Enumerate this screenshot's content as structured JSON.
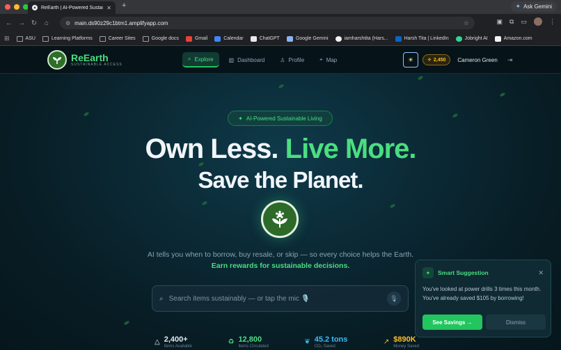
{
  "browser": {
    "tab_title": "ReEarth | AI-Powered Sustai",
    "tab_close": "✕",
    "new_tab": "+",
    "ask_gemini": "Ask Gemini",
    "url": "main.ds90z29c1btm1.amplifyapp.com",
    "bookmarks": [
      {
        "label": "ASU",
        "icon": "folder-icon"
      },
      {
        "label": "Learning Platforms",
        "icon": "folder-icon"
      },
      {
        "label": "Career Sites",
        "icon": "folder-icon"
      },
      {
        "label": "Google docs",
        "icon": "folder-icon"
      },
      {
        "label": "Gmail",
        "icon": "gmail-icon"
      },
      {
        "label": "Calendar",
        "icon": "calendar-icon"
      },
      {
        "label": "ChatGPT",
        "icon": "chatgpt-icon"
      },
      {
        "label": "Google Gemini",
        "icon": "gemini-icon"
      },
      {
        "label": "iamharshtita (Hars...",
        "icon": "github-icon"
      },
      {
        "label": "Harsh Tita | LinkedIn",
        "icon": "linkedin-icon"
      },
      {
        "label": "Jobright AI",
        "icon": "jobright-icon"
      },
      {
        "label": "Amazon.com",
        "icon": "amazon-icon"
      }
    ]
  },
  "app": {
    "brand": "ReEarth",
    "brand_sub": "SUSTAINABLE ACCESS",
    "nav": {
      "explore": "Explore",
      "dashboard": "Dashboard",
      "profile": "Profile",
      "map": "Map"
    },
    "points": "2,450",
    "user_name": "Cameron Green"
  },
  "hero": {
    "badge": "AI-Powered Sustainable Living",
    "line1_a": "Own Less.",
    "line1_b": "Live More.",
    "line2": "Save the Planet.",
    "description": "AI tells you when to borrow, buy resale, or skip — so every choice helps the Earth.",
    "description_highlight": "Earn rewards for sustainable decisions."
  },
  "search": {
    "placeholder": "Search items sustainably — or tap the mic 🎙️"
  },
  "stats": [
    {
      "value": "2,400+",
      "label": "Items Available",
      "color": "#e2e8f0"
    },
    {
      "value": "12,800",
      "label": "Items Circulated",
      "color": "#4ade80"
    },
    {
      "value": "45.2 tons",
      "label": "CO₂ Saved",
      "color": "#38bdf8"
    },
    {
      "value": "$890K",
      "label": "Money Saved",
      "color": "#fbbf24"
    }
  ],
  "toast": {
    "title": "Smart Suggestion",
    "close": "✕",
    "body": "You've looked at power drills 3 times this month. You've already saved $105 by borrowing!",
    "primary": "See Savings →",
    "secondary": "Dismiss"
  },
  "colors": {
    "accent": "#4ade80",
    "button_green": "#22c55e",
    "points_gold": "#fbbf24",
    "page_bg": "#0b2a36"
  }
}
